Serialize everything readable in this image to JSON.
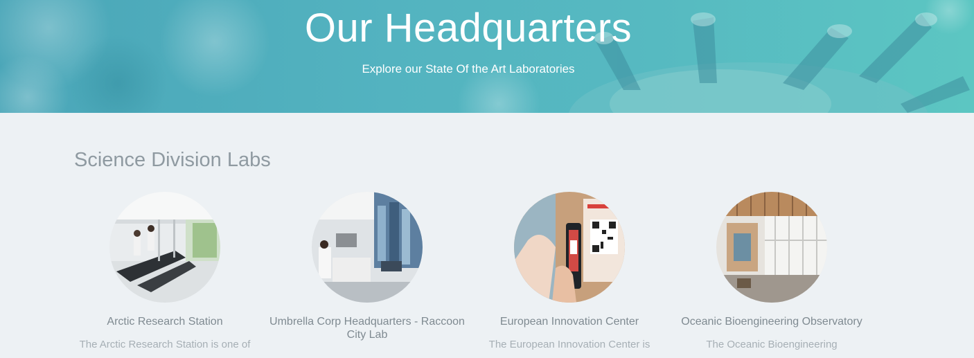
{
  "hero": {
    "title": "Our Headquarters",
    "subtitle": "Explore our State Of the Art Laboratories"
  },
  "section": {
    "title": "Science Division Labs"
  },
  "labs": [
    {
      "name": "Arctic Research Station",
      "description": "The Arctic Research Station is one of",
      "image_icon": "lab-photo"
    },
    {
      "name": "Umbrella Corp Headquarters - Raccoon City Lab",
      "description": "",
      "image_icon": "lab-photo"
    },
    {
      "name": "European Innovation Center",
      "description": "The European Innovation Center is",
      "image_icon": "qr-scan-photo"
    },
    {
      "name": "Oceanic Bioengineering Observatory",
      "description": "The Oceanic Bioengineering",
      "image_icon": "office-photo"
    }
  ],
  "colors": {
    "hero_start": "#4aa6b8",
    "hero_end": "#5cc6c2",
    "page_background": "#edf1f4",
    "section_title": "#8f9aa1",
    "lab_name": "#7f8a91",
    "lab_description": "#a6afb5"
  }
}
